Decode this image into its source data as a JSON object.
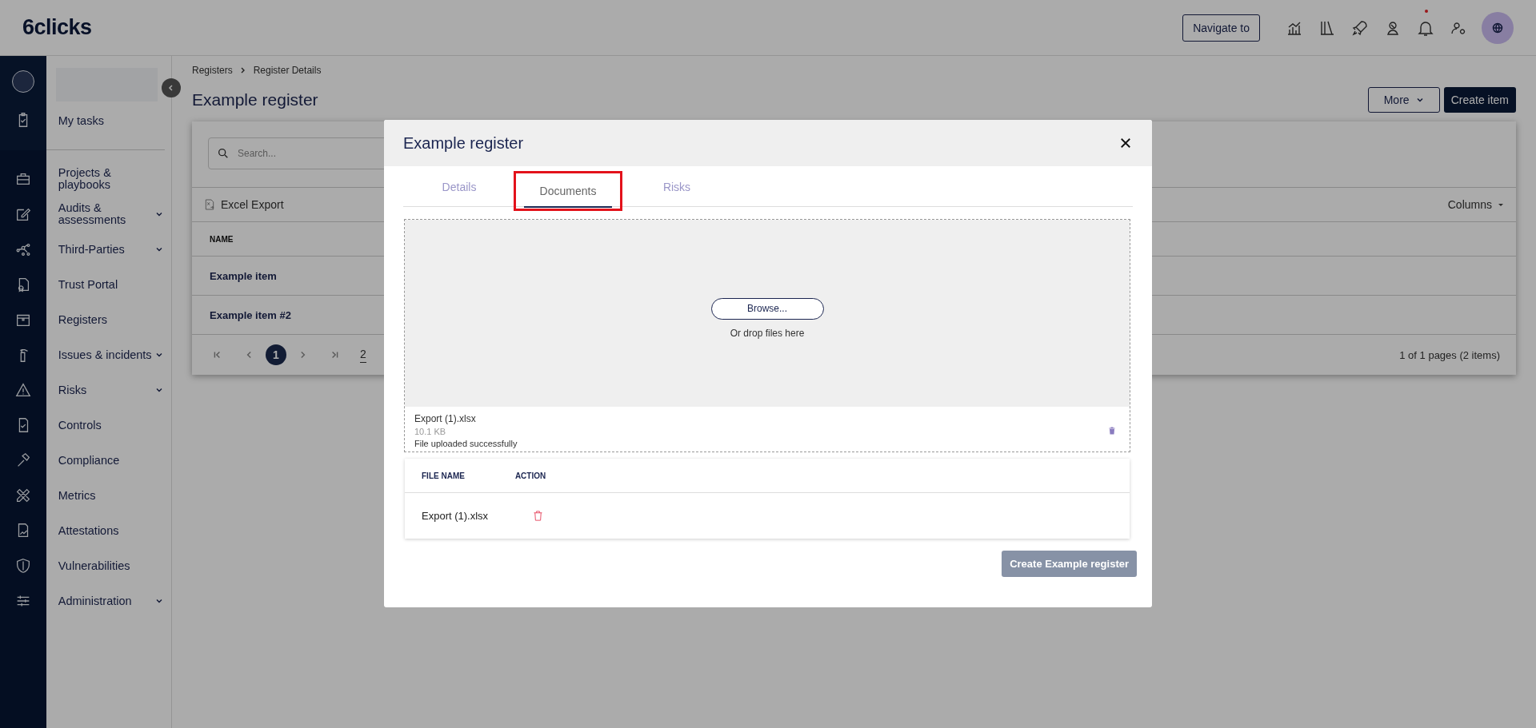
{
  "topbar": {
    "logo": "6clicks",
    "navigate_button": "Navigate to",
    "notification_dot": true
  },
  "sidebar": {
    "my_tasks": "My tasks",
    "items": [
      {
        "label": "Projects & playbooks",
        "expandable": false
      },
      {
        "label": "Audits & assessments",
        "expandable": true
      },
      {
        "label": "Third-Parties",
        "expandable": true
      },
      {
        "label": "Trust Portal",
        "expandable": false
      },
      {
        "label": "Registers",
        "expandable": false
      },
      {
        "label": "Issues & incidents",
        "expandable": true
      },
      {
        "label": "Risks",
        "expandable": true
      },
      {
        "label": "Controls",
        "expandable": false
      },
      {
        "label": "Compliance",
        "expandable": false
      },
      {
        "label": "Metrics",
        "expandable": false
      },
      {
        "label": "Attestations",
        "expandable": false
      },
      {
        "label": "Vulnerabilities",
        "expandable": false
      },
      {
        "label": "Administration",
        "expandable": true
      }
    ]
  },
  "page": {
    "breadcrumb": [
      "Registers",
      "Register Details"
    ],
    "title": "Example register",
    "more_button": "More",
    "create_button": "Create item",
    "search": {
      "placeholder": "Search..."
    },
    "export_button": "Excel Export",
    "columns_button": "Columns",
    "table": {
      "columns": [
        "NAME"
      ],
      "rows": [
        "Example item",
        "Example item #2"
      ]
    },
    "pagination": {
      "current": "1",
      "page_size": "2",
      "summary": "1 of 1 pages (2 items)"
    }
  },
  "modal": {
    "title": "Example register",
    "tabs": [
      {
        "label": "Details",
        "selected": false,
        "highlighted": false
      },
      {
        "label": "Documents",
        "selected": true,
        "highlighted": true
      },
      {
        "label": "Risks",
        "selected": false,
        "highlighted": false
      }
    ],
    "upload": {
      "browse": "Browse...",
      "hint": "Or drop files here",
      "file": {
        "name": "Export (1).xlsx",
        "size": "10.1 KB",
        "status": "File uploaded successfully"
      }
    },
    "files_table": {
      "columns": [
        "FILE NAME",
        "ACTION"
      ],
      "rows": [
        {
          "file_name": "Export (1).xlsx"
        }
      ]
    },
    "submit": {
      "label": "Create Example register",
      "disabled": true
    }
  }
}
